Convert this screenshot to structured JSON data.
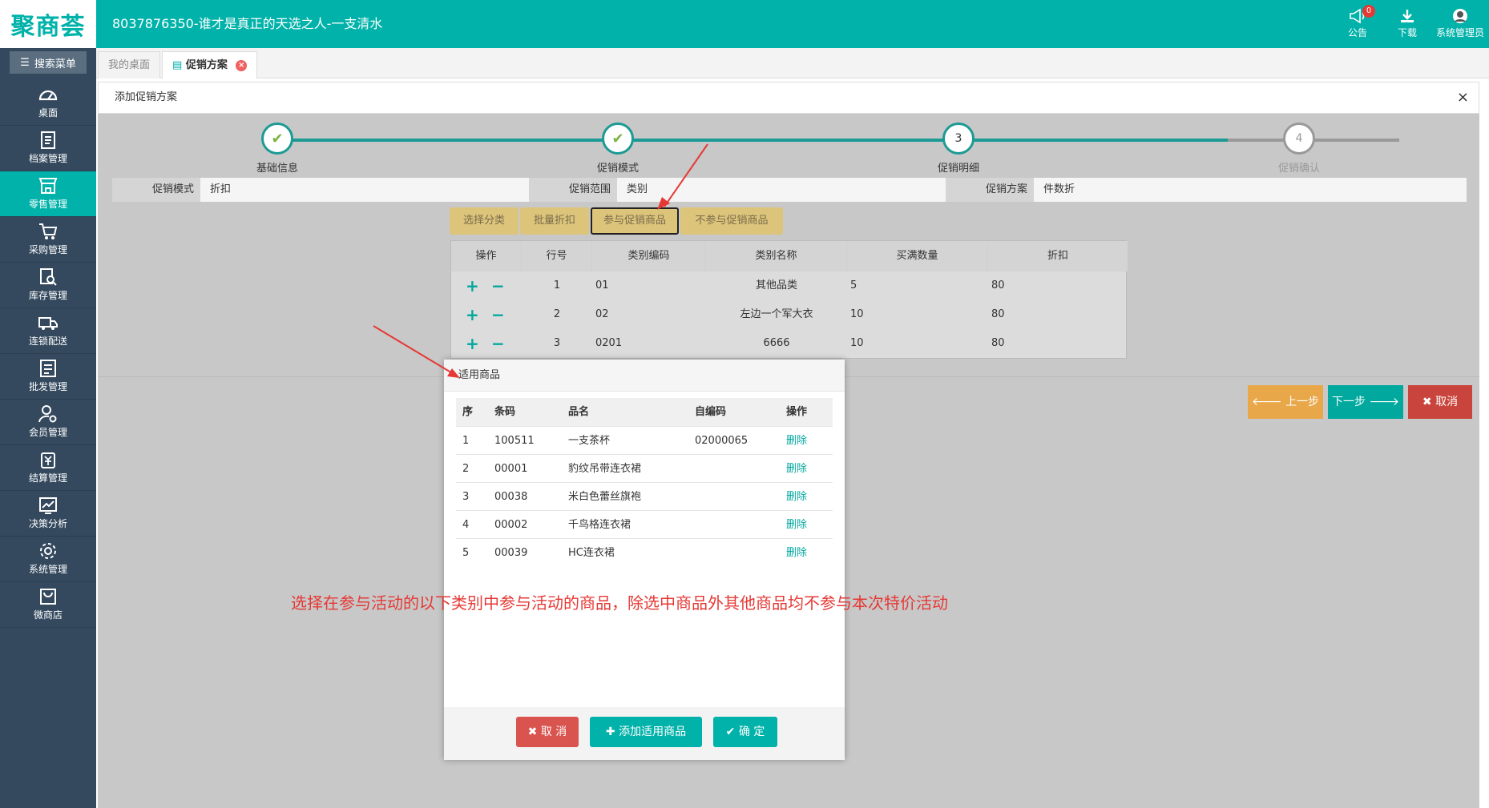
{
  "app": {
    "logo": "聚商荟",
    "title": "8037876350-谁才是真正的天选之人-一支清水"
  },
  "topbar": {
    "notice_label": "公告",
    "notice_count": "0",
    "download_label": "下载",
    "user_label": "系统管理员"
  },
  "sidebar": {
    "search_label": "搜索菜单",
    "items": [
      {
        "label": "桌面",
        "icon": "dashboard-icon"
      },
      {
        "label": "档案管理",
        "icon": "archive-icon"
      },
      {
        "label": "零售管理",
        "icon": "store-icon",
        "active": true
      },
      {
        "label": "采购管理",
        "icon": "cart-icon"
      },
      {
        "label": "库存管理",
        "icon": "inventory-search-icon"
      },
      {
        "label": "连锁配送",
        "icon": "truck-icon"
      },
      {
        "label": "批发管理",
        "icon": "wholesale-icon"
      },
      {
        "label": "会员管理",
        "icon": "member-icon"
      },
      {
        "label": "结算管理",
        "icon": "settlement-icon"
      },
      {
        "label": "决策分析",
        "icon": "chart-icon"
      },
      {
        "label": "系统管理",
        "icon": "gear-icon"
      },
      {
        "label": "微商店",
        "icon": "bag-icon"
      }
    ]
  },
  "tabs": [
    {
      "label": "我的桌面"
    },
    {
      "label": "促销方案",
      "active": true
    }
  ],
  "panel": {
    "title": "添加促销方案",
    "close": "×"
  },
  "steps": [
    {
      "num": "1",
      "label": "基础信息",
      "state": "done"
    },
    {
      "num": "2",
      "label": "促销模式",
      "state": "done"
    },
    {
      "num": "3",
      "label": "促销明细",
      "state": "current"
    },
    {
      "num": "4",
      "label": "促销确认",
      "state": "todo"
    }
  ],
  "info": {
    "mode_label": "促销模式",
    "mode_value": "折扣",
    "scope_label": "促销范围",
    "scope_value": "类别",
    "plan_label": "促销方案",
    "plan_value": "件数折"
  },
  "actions": {
    "select_category": "选择分类",
    "batch_discount": "批量折扣",
    "join_goods": "参与促销商品",
    "exclude_goods": "不参与促销商品"
  },
  "category_table": {
    "headers": [
      "操作",
      "行号",
      "类别编码",
      "类别名称",
      "买满数量",
      "折扣"
    ],
    "rows": [
      {
        "no": "1",
        "code": "01",
        "name": "其他品类",
        "qty": "5",
        "discount": "80"
      },
      {
        "no": "2",
        "code": "02",
        "name": "左边一个军大衣",
        "qty": "10",
        "discount": "80"
      },
      {
        "no": "3",
        "code": "0201",
        "name": "6666",
        "qty": "10",
        "discount": "80"
      }
    ]
  },
  "nav_buttons": {
    "prev": "上一步",
    "next": "下一步",
    "cancel": "取消"
  },
  "modal": {
    "title": "适用商品",
    "headers": [
      "序",
      "条码",
      "品名",
      "自编码",
      "操作"
    ],
    "rows": [
      {
        "seq": "1",
        "barcode": "100511",
        "name": "一支茶杯",
        "code": "02000065",
        "op": "删除"
      },
      {
        "seq": "2",
        "barcode": "00001",
        "name": "豹纹吊带连衣裙",
        "code": "",
        "op": "删除"
      },
      {
        "seq": "3",
        "barcode": "00038",
        "name": "米白色蕾丝旗袍",
        "code": "",
        "op": "删除"
      },
      {
        "seq": "4",
        "barcode": "00002",
        "name": "千鸟格连衣裙",
        "code": "",
        "op": "删除"
      },
      {
        "seq": "5",
        "barcode": "00039",
        "name": "HC连衣裙",
        "code": "",
        "op": "删除"
      }
    ],
    "cancel": "取 消",
    "add": "添加适用商品",
    "confirm": "确 定"
  },
  "annotation": "选择在参与活动的以下类别中参与活动的商品，除选中商品外其他商品均不参与本次特价活动",
  "colors": {
    "teal": "#00b2a9",
    "sidebar": "#34495e",
    "gold": "#dcc47a",
    "orange": "#e8a84a",
    "red": "#c9443c",
    "arrow": "#e53935"
  }
}
